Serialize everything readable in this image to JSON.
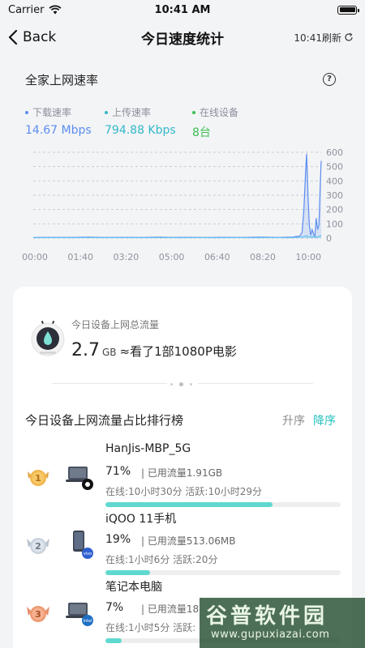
{
  "status_bar": {
    "carrier": "Carrier",
    "time": "10:41 AM"
  },
  "nav": {
    "back_label": "Back",
    "title": "今日速度统计",
    "refresh_label": "10:41刷新"
  },
  "speed_section": {
    "title": "全家上网速率",
    "stats": [
      {
        "label": "下载速率",
        "value": "14.67 Mbps",
        "color": "#5b8def"
      },
      {
        "label": "上传速率",
        "value": "794.88 Kbps",
        "color": "#33b8c9"
      },
      {
        "label": "在线设备",
        "value": "8台",
        "color": "#3cbf52"
      }
    ]
  },
  "chart_data": {
    "type": "area",
    "x_ticks": [
      "00:00",
      "01:40",
      "03:20",
      "05:00",
      "06:40",
      "08:20",
      "10:00"
    ],
    "y_ticks": [
      "600",
      "500",
      "400",
      "300",
      "200",
      "100",
      "0"
    ],
    "ylim": [
      0,
      600
    ],
    "xlim": [
      0,
      632
    ],
    "grid": true,
    "series": [
      {
        "color": "#5b8def",
        "points": [
          [
            0,
            5
          ],
          [
            40,
            6
          ],
          [
            80,
            5
          ],
          [
            120,
            7
          ],
          [
            160,
            5
          ],
          [
            200,
            6
          ],
          [
            240,
            5
          ],
          [
            280,
            7
          ],
          [
            300,
            5
          ],
          [
            340,
            6
          ],
          [
            380,
            5
          ],
          [
            420,
            6
          ],
          [
            460,
            5
          ],
          [
            500,
            7
          ],
          [
            540,
            5
          ],
          [
            570,
            8
          ],
          [
            585,
            15
          ],
          [
            590,
            40
          ],
          [
            594,
            200
          ],
          [
            598,
            480
          ],
          [
            600,
            590
          ],
          [
            603,
            300
          ],
          [
            606,
            90
          ],
          [
            609,
            20
          ],
          [
            612,
            60
          ],
          [
            615,
            30
          ],
          [
            618,
            10
          ],
          [
            621,
            140
          ],
          [
            624,
            60
          ],
          [
            627,
            90
          ],
          [
            630,
            380
          ],
          [
            632,
            540
          ]
        ]
      },
      {
        "color": "#6fc6f0",
        "points": [
          [
            0,
            3
          ],
          [
            40,
            4
          ],
          [
            80,
            3
          ],
          [
            120,
            4
          ],
          [
            160,
            3
          ],
          [
            200,
            4
          ],
          [
            240,
            3
          ],
          [
            280,
            4
          ],
          [
            320,
            3
          ],
          [
            360,
            4
          ],
          [
            400,
            3
          ],
          [
            440,
            4
          ],
          [
            480,
            3
          ],
          [
            520,
            4
          ],
          [
            560,
            3
          ],
          [
            585,
            6
          ],
          [
            594,
            12
          ],
          [
            600,
            18
          ],
          [
            606,
            8
          ],
          [
            615,
            12
          ],
          [
            624,
            8
          ],
          [
            632,
            20
          ]
        ]
      }
    ]
  },
  "usage": {
    "total_label": "今日设备上网总流量",
    "total_value": "2.7",
    "total_unit": "GB",
    "total_desc": "≈看了1部1080P电影"
  },
  "ranking": {
    "title": "今日设备上网流量占比排行榜",
    "sort_asc": "升序",
    "sort_desc": "降序",
    "devices": [
      {
        "rank": "1",
        "name": "HanJis-MBP_5G",
        "percent": "71%",
        "percent_num": 71,
        "used": "| 已用流量1.91GB",
        "online": "在线:10小时30分  活跃:10小时29分",
        "icon": "laptop-apple-icon"
      },
      {
        "rank": "2",
        "name": "iQOO 11手机",
        "percent": "19%",
        "percent_num": 19,
        "used": "| 已用流量513.06MB",
        "online": "在线:1小时6分  活跃:20分",
        "icon": "phone-vivo-icon"
      },
      {
        "rank": "3",
        "name": "笔记本电脑",
        "percent": "7%",
        "percent_num": 7,
        "used": "| 已用流量18",
        "online": "在线:1小时5分  活跃:",
        "icon": "laptop-intel-icon"
      }
    ]
  },
  "watermark": {
    "title": "谷普软件园",
    "url": "www.gupuxiazai.com"
  }
}
